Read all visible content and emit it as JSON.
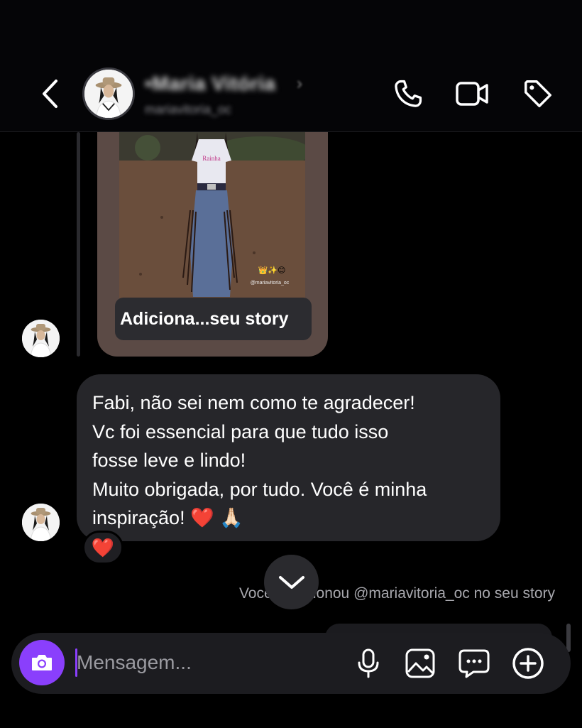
{
  "header": {
    "contact_name": "•Maria Vitória",
    "contact_username": "mariavitoria_oc",
    "chevron": "›"
  },
  "icons": {
    "back": "chevron-left-icon",
    "call": "phone-icon",
    "video": "video-camera-icon",
    "tag": "tag-icon",
    "camera": "camera-icon",
    "mic": "microphone-icon",
    "gallery": "image-icon",
    "sticker": "chat-bubble-icon",
    "add": "plus-circle-icon",
    "scroll": "chevron-down-icon"
  },
  "story": {
    "caption": "Adiciona...seu story",
    "overlay_handle": "@mariavitoria_oc"
  },
  "message": {
    "text_main": "Fabi, não sei nem como te agradecer!\nVc foi essencial para que tudo isso\nfosse leve e lindo!\nMuito obrigada, por tudo. Você é minha\ninspiração! ",
    "emoji_heart": "❤️",
    "emoji_pray": "🙏🏻",
    "reaction": "❤️"
  },
  "mention": {
    "text": "Você mencionou @mariavitoria_oc no seu story"
  },
  "composer": {
    "placeholder": "Mensagem..."
  },
  "colors": {
    "accent": "#8a3ffc",
    "bubble": "#26262a",
    "heart": "#e41e3f"
  }
}
